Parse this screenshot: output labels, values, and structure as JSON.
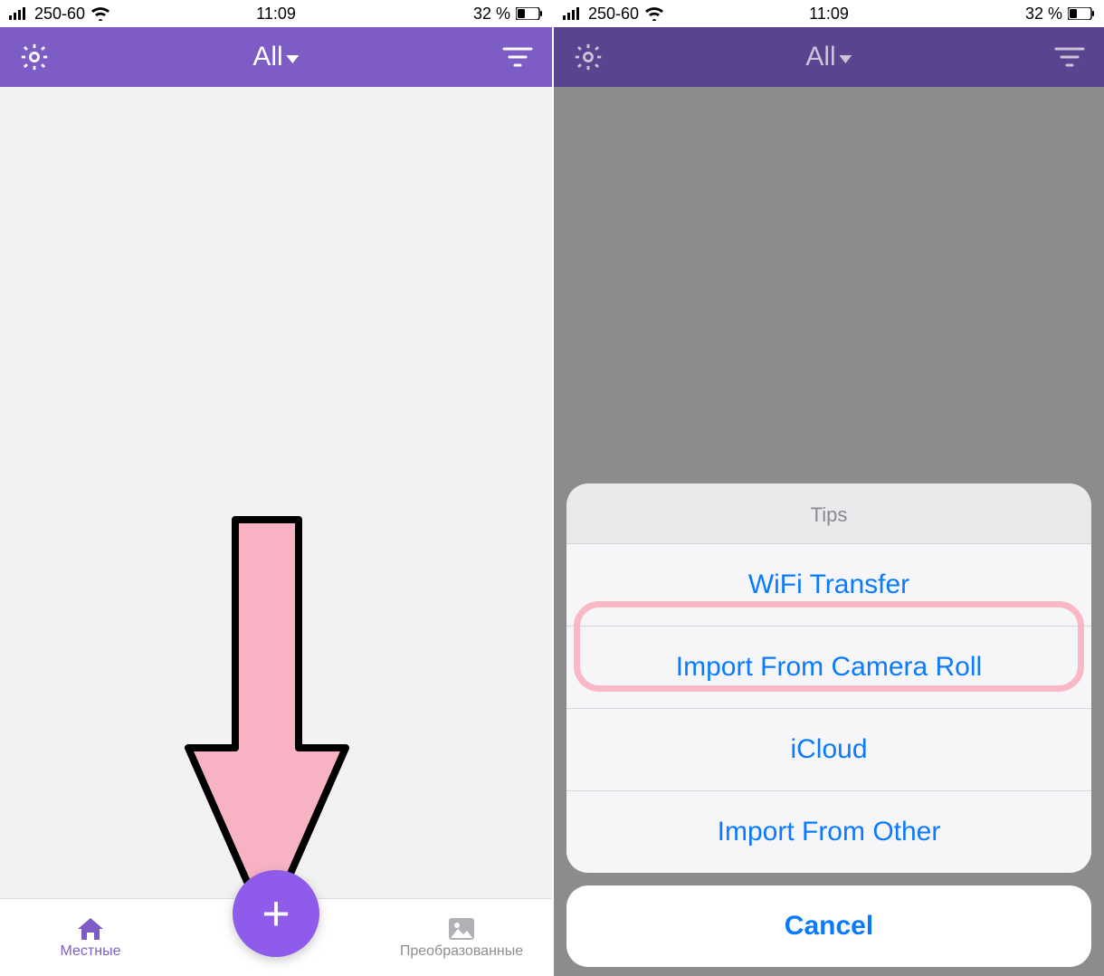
{
  "status": {
    "carrier": "250-60",
    "time": "11:09",
    "battery": "32 %"
  },
  "nav": {
    "title": "All"
  },
  "tabs": {
    "left": "Местные",
    "right": "Преобразованные"
  },
  "sheet": {
    "title": "Tips",
    "items": [
      "WiFi Transfer",
      "Import From Camera Roll",
      "iCloud",
      "Import From Other"
    ],
    "cancel": "Cancel"
  }
}
